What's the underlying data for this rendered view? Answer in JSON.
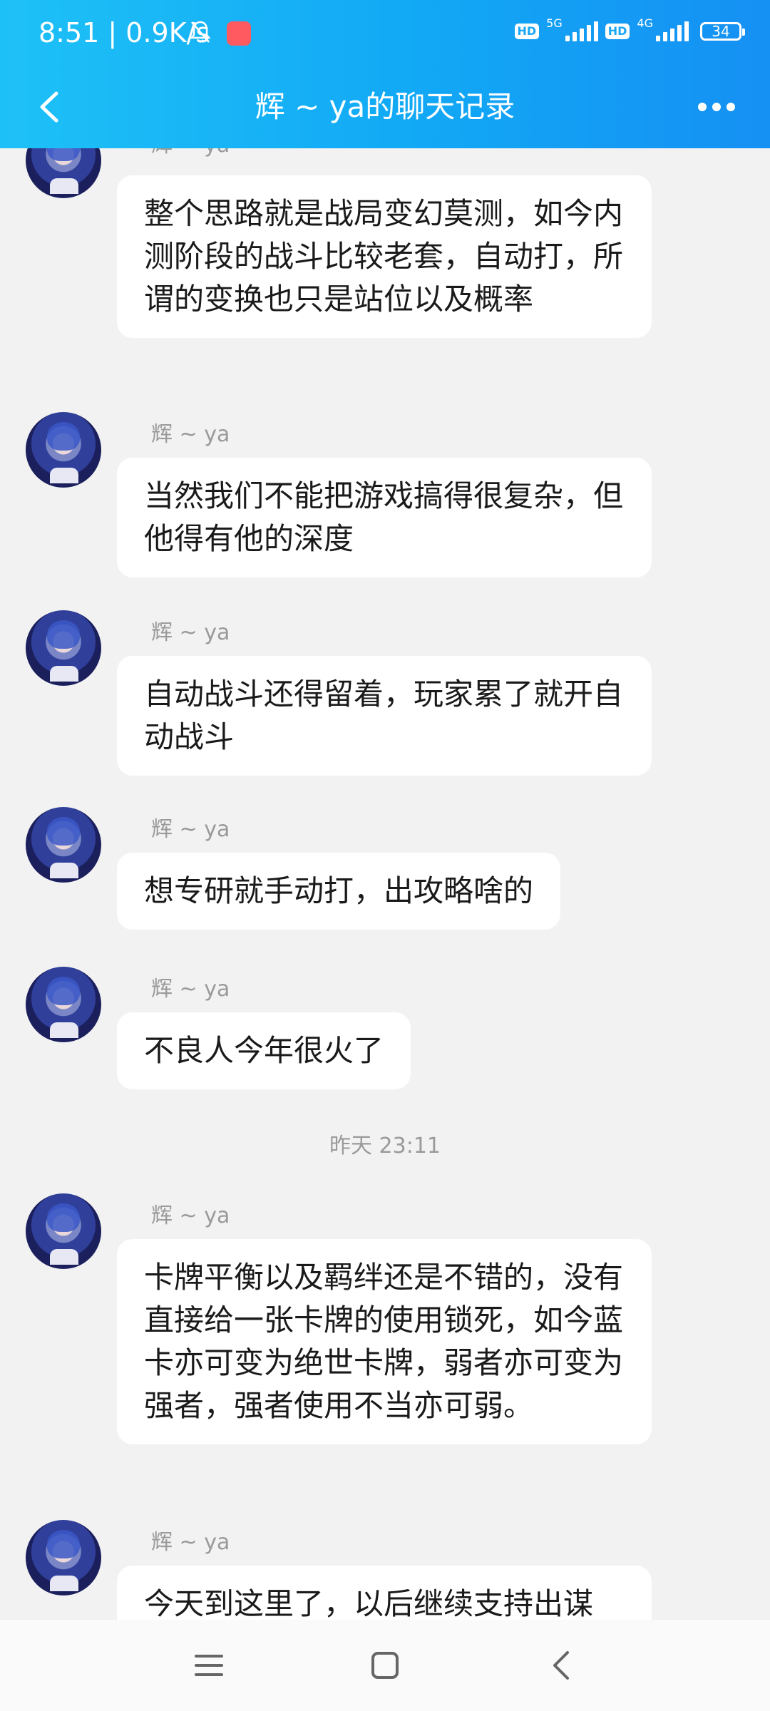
{
  "status_bar": {
    "time": "8:51 | 0.9K/s",
    "network1": "5G",
    "network2": "4G",
    "hd_label": "HD",
    "battery": "34"
  },
  "header": {
    "title": "辉 ~ ya的聊天记录"
  },
  "messages": [
    {
      "sender": "辉 ~ ya",
      "text": "整个思路就是战局变幻莫测，如今内测阶段的战斗比较老套，自动打，所谓的变换也只是站位以及概率"
    },
    {
      "sender": "辉 ~ ya",
      "text": "当然我们不能把游戏搞得很复杂，但他得有他的深度"
    },
    {
      "sender": "辉 ~ ya",
      "text": "自动战斗还得留着，玩家累了就开自动战斗"
    },
    {
      "sender": "辉 ~ ya",
      "text": "想专研就手动打，出攻略啥的"
    },
    {
      "sender": "辉 ~ ya",
      "text": "不良人今年很火了"
    },
    {
      "sender": "辉 ~ ya",
      "text": "卡牌平衡以及羁绊还是不错的，没有直接给一张卡牌的使用锁死，如今蓝卡亦可变为绝世卡牌，弱者亦可变为强者，强者使用不当亦可弱。"
    },
    {
      "sender": "辉 ~ ya",
      "text": "今天到这里了，以后继续支持出谋"
    }
  ],
  "time_divider": "昨天 23:11"
}
